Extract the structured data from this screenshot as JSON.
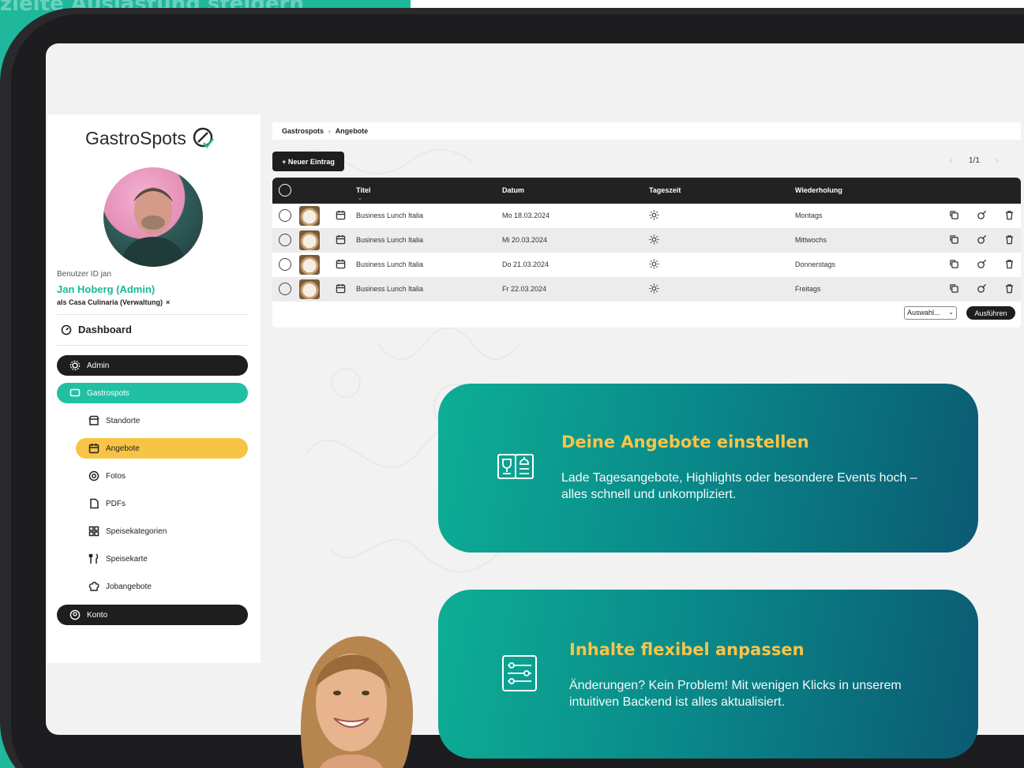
{
  "background_text": "zielte Auslastung steigern",
  "sidebar": {
    "logo_text": "GastroSpots",
    "user_id_label": "Benutzer ID jan",
    "user_name": "Jan Hoberg (Admin)",
    "user_context": "als Casa Culinaria (Verwaltung)",
    "user_context_close": "×",
    "dashboard_label": "Dashboard",
    "nav": {
      "admin": "Admin",
      "gastrospots": "Gastrospots",
      "konto": "Konto"
    },
    "sub_items": [
      {
        "label": "Standorte",
        "icon": "store-icon"
      },
      {
        "label": "Angebote",
        "icon": "calendar-edit-icon",
        "active": true
      },
      {
        "label": "Fotos",
        "icon": "camera-icon"
      },
      {
        "label": "PDFs",
        "icon": "pdf-icon"
      },
      {
        "label": "Speisekategorien",
        "icon": "grid-icon"
      },
      {
        "label": "Speisekarte",
        "icon": "cutlery-icon"
      },
      {
        "label": "Jobangebote",
        "icon": "chef-hat-icon"
      }
    ]
  },
  "breadcrumb": {
    "root": "Gastrospots",
    "separator": "›",
    "current": "Angebote"
  },
  "toolbar": {
    "new_entry_label": "+ Neuer Eintrag",
    "page_indicator": "1/1",
    "prev": "‹",
    "next": "›"
  },
  "table": {
    "columns": {
      "title": "Titel",
      "date": "Datum",
      "daytime": "Tageszeit",
      "repeat": "Wiederholung"
    },
    "rows": [
      {
        "title": "Business Lunch Italia",
        "date": "Mo 18.03.2024",
        "daytime_icon": "sun-icon",
        "repeat": "Montags"
      },
      {
        "title": "Business Lunch Italia",
        "date": "Mi 20.03.2024",
        "daytime_icon": "sun-icon",
        "repeat": "Mittwochs"
      },
      {
        "title": "Business Lunch Italia",
        "date": "Do 21.03.2024",
        "daytime_icon": "sun-icon",
        "repeat": "Donnerstags"
      },
      {
        "title": "Business Lunch Italia",
        "date": "Fr 22.03.2024",
        "daytime_icon": "sun-icon",
        "repeat": "Freitags"
      }
    ],
    "select_label": "Auswahl...",
    "run_label": "Ausführen"
  },
  "cards": [
    {
      "title": "Deine Angebote einstellen",
      "text": "Lade Tagesangebote, Highlights oder besondere Events hoch – alles schnell und unkompliziert.",
      "icon": "menu-book-icon"
    },
    {
      "title": "Inhalte flexibel anpassen",
      "text": "Änderungen? Kein Problem! Mit wenigen Klicks in unserem intuitiven Backend ist alles aktualisiert.",
      "icon": "sliders-icon"
    }
  ],
  "colors": {
    "brand_teal": "#21c0a4",
    "accent_yellow": "#f8c446",
    "dark": "#1e1e1e",
    "card_title": "#f7c44a"
  }
}
